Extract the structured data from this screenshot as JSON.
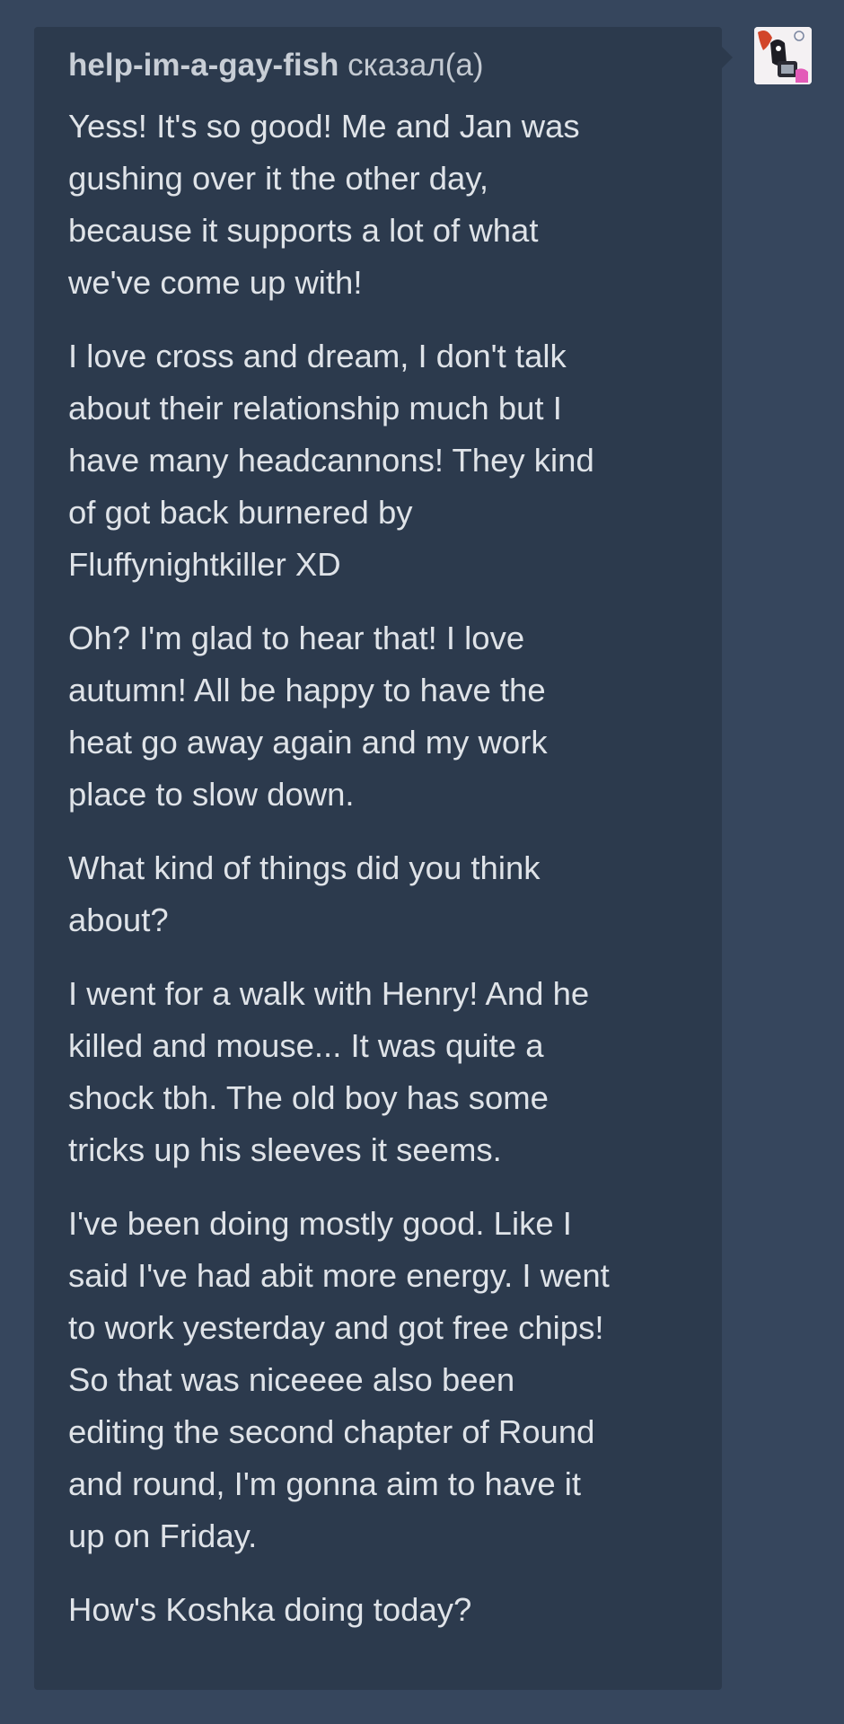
{
  "post": {
    "username": "help-im-a-gay-fish",
    "said_label": "сказал(а)",
    "paragraphs": [
      "Yess! It's so good! Me and Jan was\ngushing over it the other day,\nbecause it supports a lot of what\nwe've come up with!",
      "I love cross and dream, I don't talk\nabout their relationship much but I\nhave many headcannons! They kind\nof got back burnered by\nFluffynightkiller XD",
      "Oh? I'm glad to hear that! I love\nautumn! All be happy to have the\nheat go away again and my work\nplace to slow down.",
      "What kind of things did you think\nabout?",
      "I went for a walk with Henry! And he\nkilled and mouse... It was quite a\nshock tbh. The old boy has some\ntricks up his sleeves it seems.",
      "I've been doing mostly good. Like I\nsaid I've had abit more energy. I went\nto work yesterday and got free chips!\nSo that was niceeee also been\nediting the second chapter of Round\nand round, I'm gonna aim to have it\nup on Friday.",
      "How's Koshka doing today?"
    ]
  },
  "avatar": {
    "icon": "user-avatar-icon"
  },
  "colors": {
    "page_background": "#36465d",
    "bubble_background": "#2c3a4d",
    "text": "#dfe3e8"
  }
}
